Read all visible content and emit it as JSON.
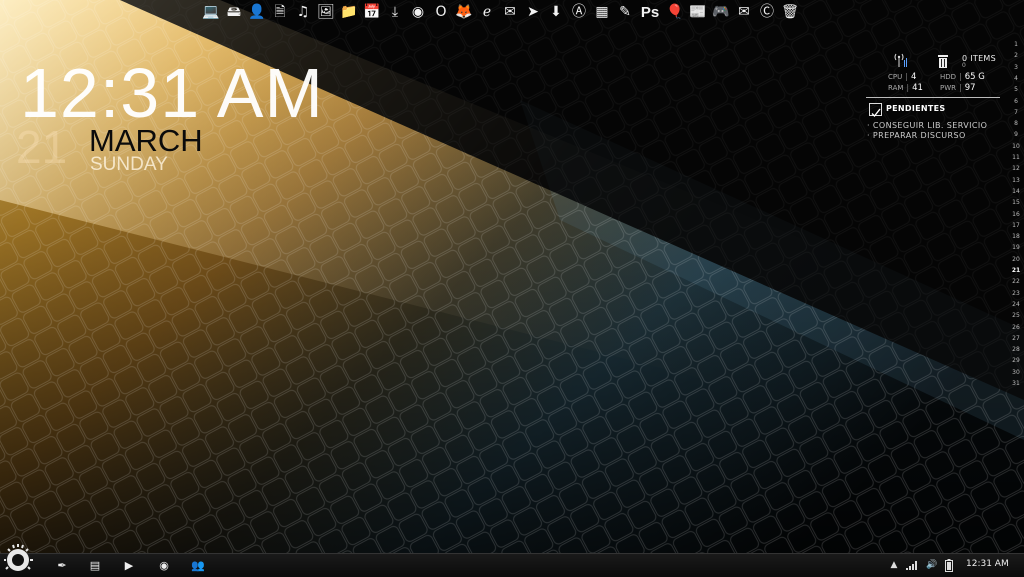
{
  "dock": {
    "icons": [
      "computer-icon",
      "hard-drive-icon",
      "user-icon",
      "documents-icon",
      "music-icon",
      "pictures-icon",
      "folder-icon",
      "calendar-icon",
      "downloads-icon",
      "chrome-icon",
      "opera-icon",
      "firefox-icon",
      "internet-explorer-icon",
      "email-icon",
      "cursor-icon",
      "torrent-icon",
      "anarchy-icon",
      "calculator-icon",
      "notepad-icon",
      "photoshop-icon",
      "balloon-icon",
      "news-icon",
      "gamepad-icon",
      "inbox-icon",
      "ccleaner-icon",
      "trash-icon"
    ],
    "photoshop_label": "Ps"
  },
  "clock": {
    "time": "12:31 AM",
    "day": "21",
    "month": "MARCH",
    "weekday": "SUNDAY"
  },
  "sysmon": {
    "items_label": "0 ITEMS",
    "items_sub": "0",
    "cpu_label": "CPU",
    "cpu_value": "4",
    "ram_label": "RAM",
    "ram_value": "41",
    "hdd_label": "HDD",
    "hdd_value": "65 G",
    "pwr_label": "PWR",
    "pwr_value": "97",
    "separator": "|"
  },
  "todo": {
    "title": "PENDIENTES",
    "items": [
      "· CONSEGUIR LIB. SERVICIO",
      "· PREPARAR DISCURSO"
    ]
  },
  "calendar": {
    "days": [
      "1",
      "2",
      "3",
      "4",
      "5",
      "6",
      "7",
      "8",
      "9",
      "10",
      "11",
      "12",
      "13",
      "14",
      "15",
      "16",
      "17",
      "18",
      "19",
      "20",
      "21",
      "22",
      "23",
      "24",
      "25",
      "26",
      "27",
      "28",
      "29",
      "30",
      "31"
    ],
    "today": "21"
  },
  "taskbar": {
    "icons": [
      "feather-icon",
      "explorer-icon",
      "media-play-icon",
      "chrome-icon",
      "contacts-icon"
    ],
    "tray_icons": [
      "show-hidden-icon",
      "signal-icon",
      "volume-icon",
      "battery-icon"
    ],
    "time": "12:31 AM"
  },
  "colors": {
    "accent_orange": "#e8a030",
    "accent_blue": "#4a8aa8",
    "taskbar": "#111111"
  }
}
